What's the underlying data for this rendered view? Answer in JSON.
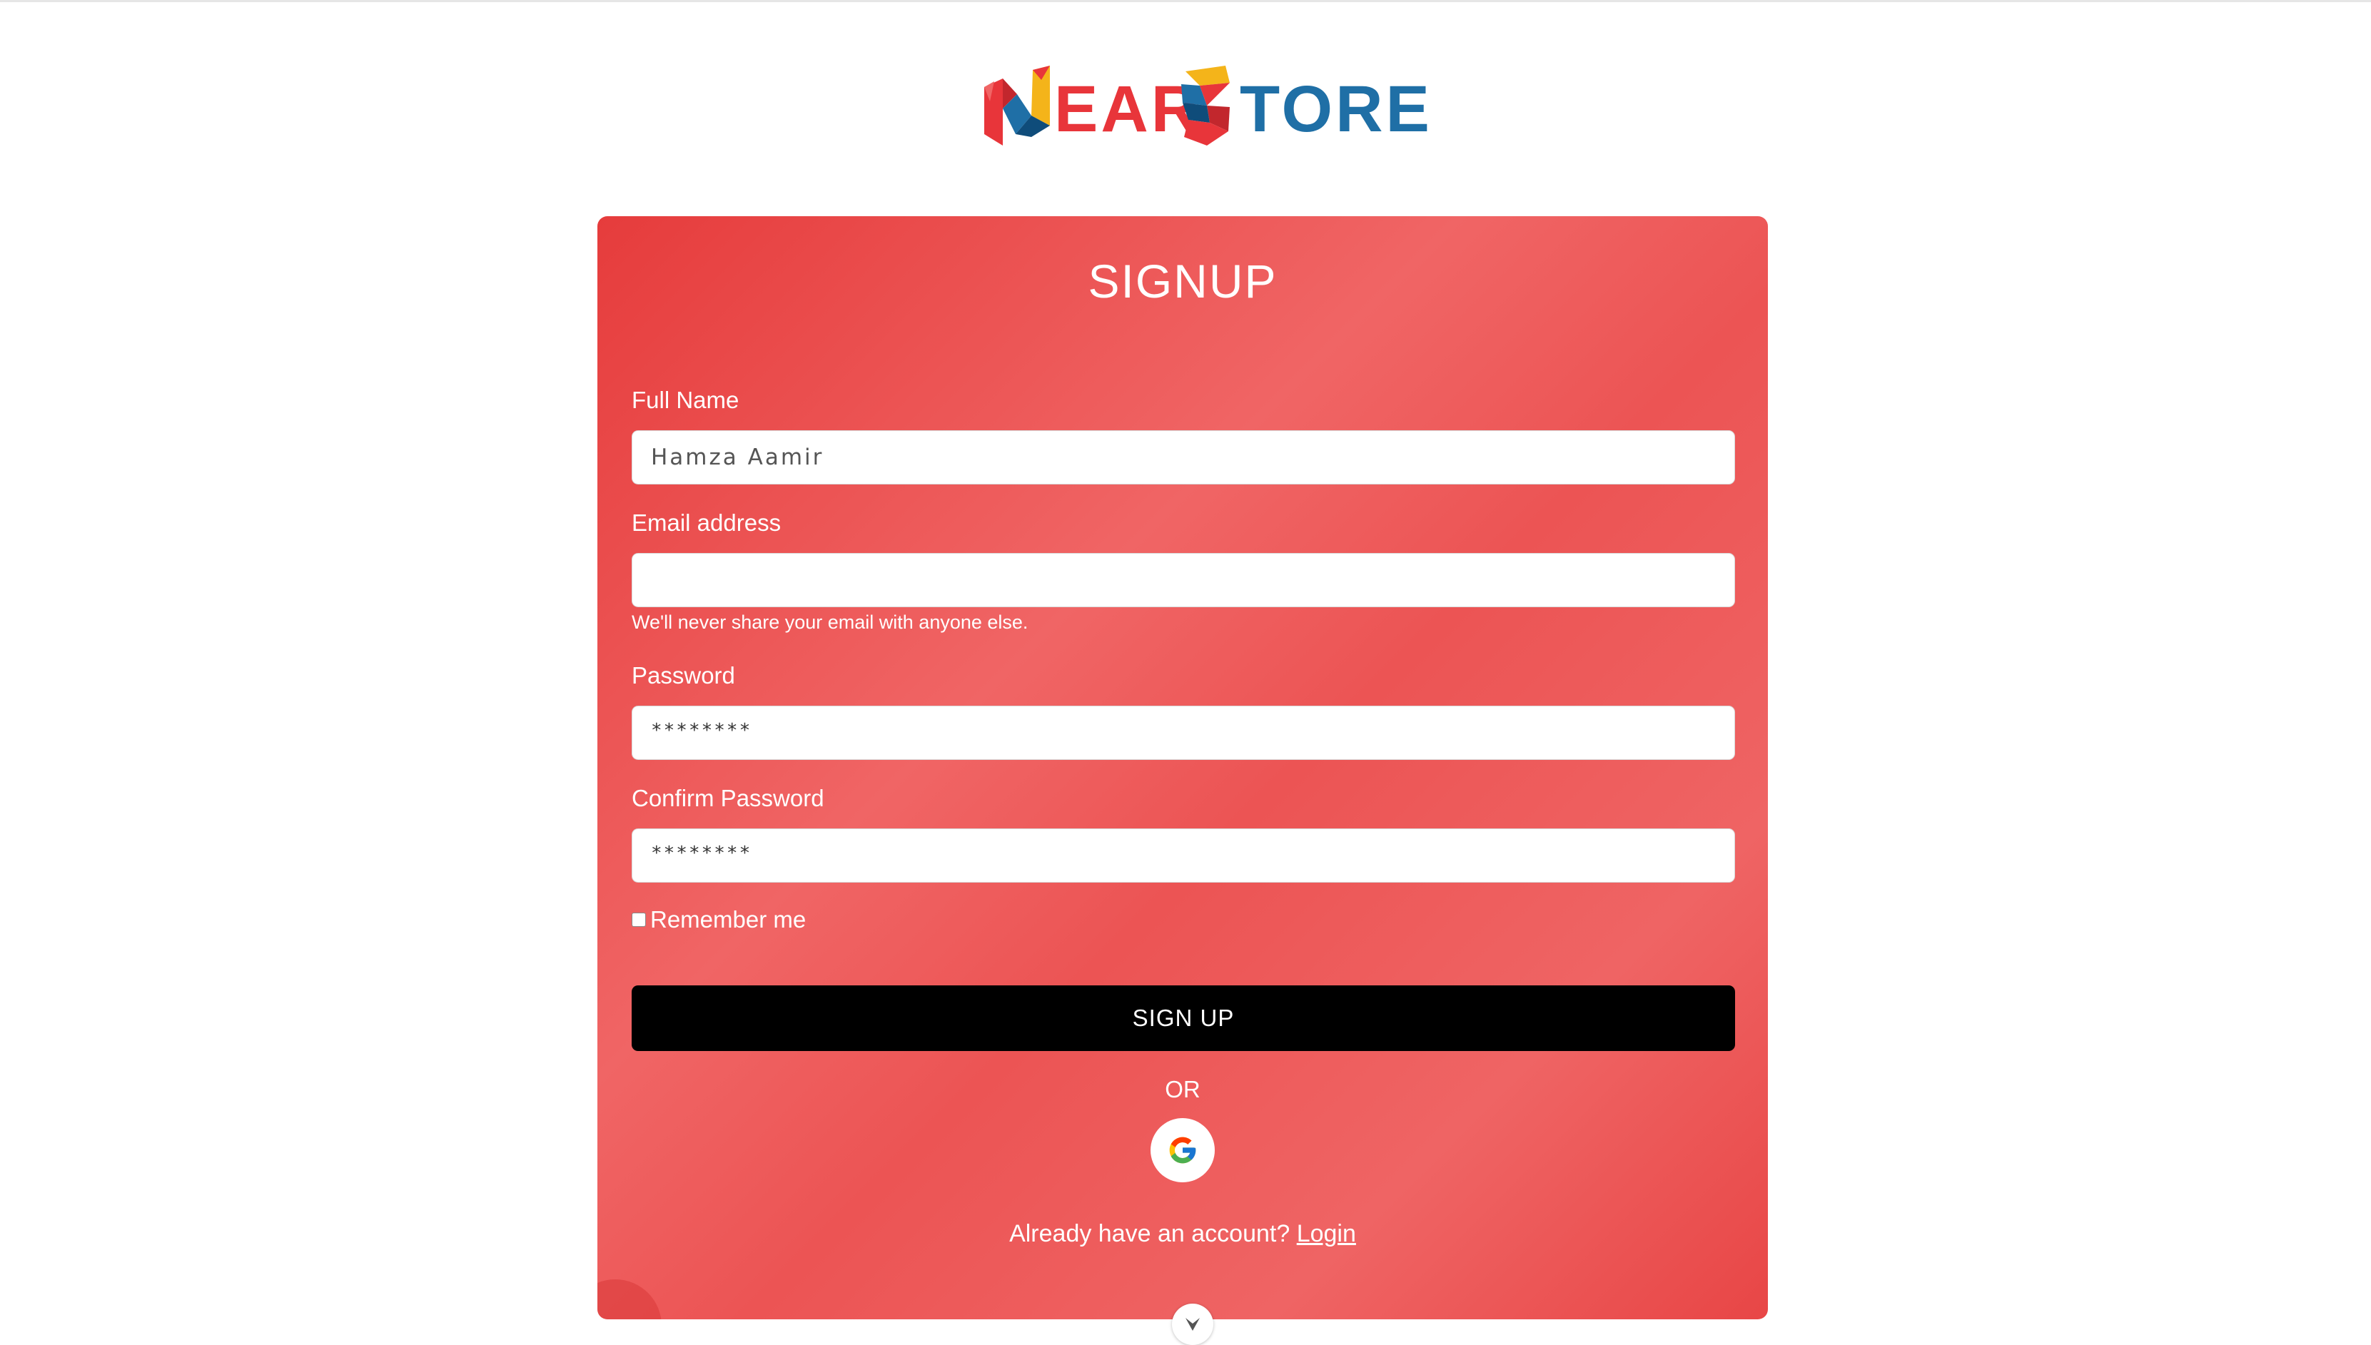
{
  "brand": {
    "logo_word_1": "EAR",
    "logo_word_2": "TORE",
    "colors": {
      "red": "#e8353a",
      "blue": "#1f6fa6",
      "yellow": "#f4b41a"
    }
  },
  "form": {
    "title": "SIGNUP",
    "full_name": {
      "label": "Full Name",
      "value": "Hamza Aamir"
    },
    "email": {
      "label": "Email address",
      "value": "",
      "hint": "We'll never share your email with anyone else."
    },
    "password": {
      "label": "Password",
      "value": "********"
    },
    "confirm_password": {
      "label": "Confirm Password",
      "value": "********"
    },
    "remember": {
      "label": "Remember me",
      "checked": false
    },
    "submit_label": "SIGN UP",
    "divider_text": "OR",
    "google_icon": "google-icon",
    "account_prompt": "Already have an account?",
    "login_link": "Login"
  },
  "colors": {
    "card_gradient_start": "#e63c3c",
    "card_gradient_mid": "#f06565",
    "button_bg": "#000000",
    "text_on_card": "#ffffff"
  },
  "scroll_icon": "chevron-down-icon"
}
